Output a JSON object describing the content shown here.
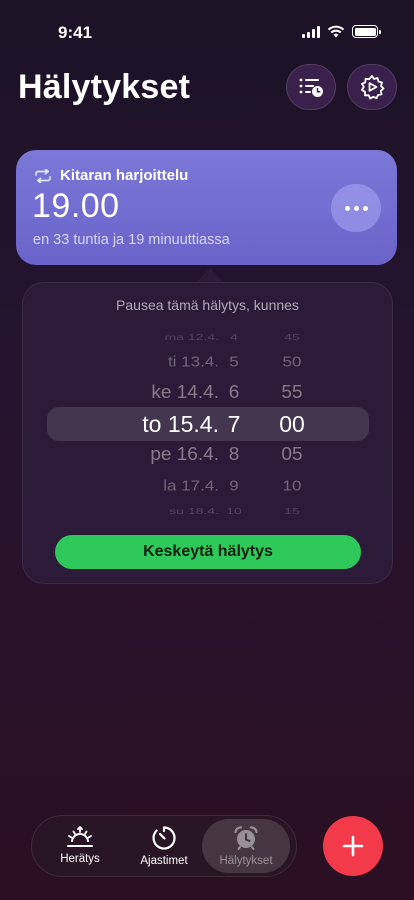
{
  "status_bar": {
    "time": "9:41"
  },
  "header": {
    "title": "Hälytykset",
    "list_button_icon": "list-clock-icon",
    "settings_button_icon": "gear-icon"
  },
  "alarm": {
    "name": "Kitaran harjoittelu",
    "repeat_icon": "repeat-icon",
    "time": "19.00",
    "subtitle": "en 33 tuntia ja 19 minuuttiassa",
    "more_icon": "more-icon"
  },
  "pause": {
    "title": "Pausea tämä hälytys, kunnes",
    "rows": [
      {
        "date": "ma 12.4.",
        "hour": "4",
        "minute": "45"
      },
      {
        "date": "ti 13.4.",
        "hour": "5",
        "minute": "50"
      },
      {
        "date": "ke 14.4.",
        "hour": "6",
        "minute": "55"
      },
      {
        "date": "to 15.4.",
        "hour": "7",
        "minute": "00"
      },
      {
        "date": "pe 16.4.",
        "hour": "8",
        "minute": "05"
      },
      {
        "date": "la 17.4.",
        "hour": "9",
        "minute": "10"
      },
      {
        "date": "su 18.4.",
        "hour": "10",
        "minute": "15"
      }
    ],
    "selected_index": 3,
    "cancel_button": "Keskeytä hälytys"
  },
  "tabs": [
    {
      "label": "Herätys",
      "icon": "sunrise-icon"
    },
    {
      "label": "Ajastimet",
      "icon": "timer-icon"
    },
    {
      "label": "Hälytykset",
      "icon": "alarm-clock-icon"
    }
  ],
  "add_button_icon": "plus-icon",
  "colors": {
    "card": "#7b78d8",
    "accent_green": "#2fc95b",
    "add_red": "#f23a4a"
  }
}
